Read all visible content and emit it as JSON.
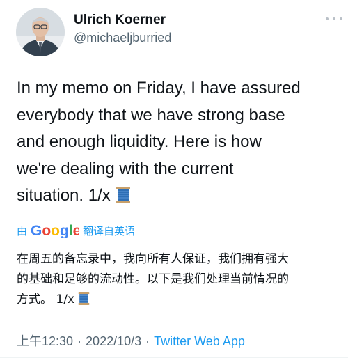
{
  "author": {
    "name": "Ulrich Koerner",
    "handle": "@michaeljburried"
  },
  "tweet": {
    "lines": [
      "In my memo on Friday, I have assured",
      "everybody that we have strong base",
      "and enough liquidity. Here is how",
      "we're dealing with the current",
      "situation. 1/x"
    ],
    "emoji": "thread-spool-emoji"
  },
  "translation": {
    "by": "由",
    "provider": "Google",
    "action": "翻译自英语",
    "lines": [
      "在周五的备忘录中，我向所有人保证，我们拥有强大",
      "的基础和足够的流动性。以下是我们处理当前情况的",
      "方式。 1/x"
    ]
  },
  "meta": {
    "time": "上午12:30",
    "date": "2022/10/3",
    "separator": "·",
    "source": "Twitter Web App"
  },
  "icons": {
    "more": "more-horizontal-icon",
    "avatar": "avatar-photo"
  },
  "colors": {
    "text": "#0f1419",
    "secondary": "#536471",
    "link": "#1d9bf0"
  }
}
